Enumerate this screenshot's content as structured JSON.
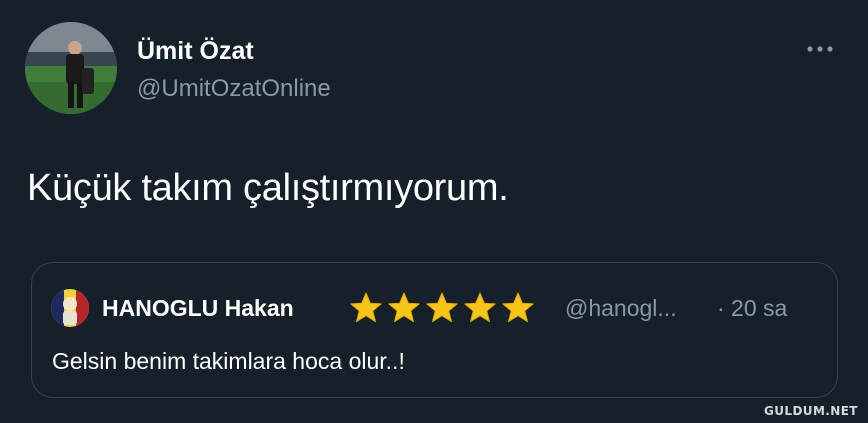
{
  "author": {
    "name": "Ümit Özat",
    "handle": "@UmitOzatOnline"
  },
  "tweet": {
    "text": "Küçük takım çalıştırmıyorum."
  },
  "quoted_tweet": {
    "name": "HANOGLU Hakan",
    "star_count": 5,
    "handle": "@hanogl...",
    "time": "· 20 sa",
    "text": "Gelsin benim takimlara hoca olur..!"
  },
  "icons": {
    "more": "more-horizontal-icon",
    "star": "star-emoji-icon"
  },
  "colors": {
    "background": "#15202b",
    "secondary_text": "#8b98a5",
    "border": "#38444d",
    "star": "#f5c518"
  },
  "watermark": "GULDUM.NET"
}
